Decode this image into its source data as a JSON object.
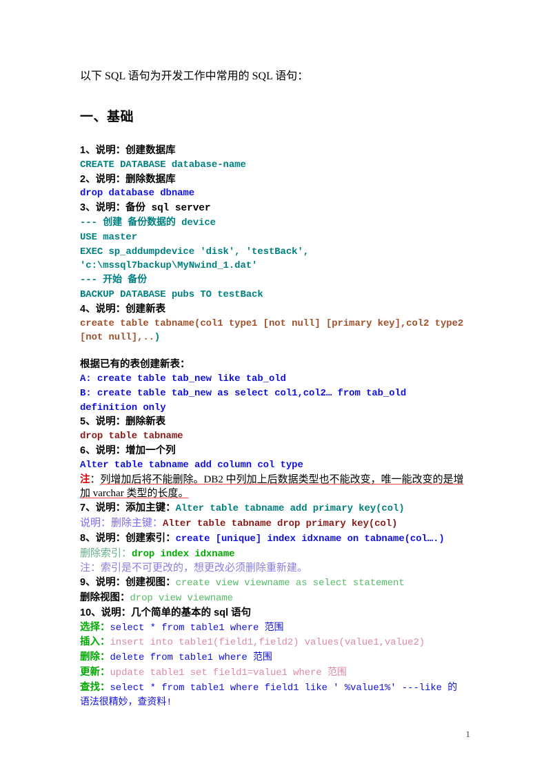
{
  "document": {
    "intro": "以下 SQL 语句为开发工作中常用的 SQL 语句：",
    "section_heading": "一、基础",
    "page_number": "1"
  },
  "colors": {
    "teal": "#008080",
    "blue": "#1111dd",
    "brown": "#a0522d",
    "dark_red": "#8b1a1a",
    "red": "#dd0000",
    "green": "#00aa00",
    "light_green": "#55bb66",
    "purple": "#7b68ee",
    "pink": "#dd88aa",
    "black": "#000000"
  },
  "items": {
    "i1_header": "1、说明：创建数据库",
    "i1_code": "CREATE DATABASE database-name",
    "i2_header": "2、说明：删除数据库",
    "i2_code": "drop database dbname",
    "i3_header_a": "3、说明：",
    "i3_header_b": "备份 sql server",
    "i3_comment1": "--- 创建 备份数据的 device",
    "i3_code1": "USE master",
    "i3_code2": "EXEC sp_addumpdevice 'disk', 'testBack', 'c:\\mssql7backup\\MyNwind_1.dat'",
    "i3_comment2": "--- 开始 备份",
    "i3_code3": "BACKUP DATABASE pubs TO testBack",
    "i4_header": "4、说明：创建新表",
    "i4_code": "create table tabname(col1 type1 [not null] [primary key],col2 type2 [not null],..",
    "i4_code_tail": ")",
    "i4b_header": "根据已有的表创建新表：",
    "i4b_code_a": "A: create table tab_new like tab_old",
    "i4b_code_b": "B: create table tab_new as select col1,col2… from tab_old definition only",
    "i5_header": "5、说明：删除新表",
    "i5_code": "drop table tabname",
    "i6_header": "6、说明：增加一个列",
    "i6_code": "Alter table tabname add column col type",
    "i6_note_label": "注",
    "i6_note_sep": "：",
    "i6_note_text": "列增加后将不能删除。DB2 中列加上后数据类型也不能改变，唯一能改变的是增加 varchar 类型的长度。",
    "i7_header": "7、说明：添加主键：",
    "i7_code": "Alter table tabname add primary key(col)",
    "i7_sub_label": "说明：",
    "i7_sub_label2": "删除主键：",
    "i7_sub_code": "Alter table tabname drop primary key(col)",
    "i8_header": "8、说明：创建索引：",
    "i8_code": "create [unique] index idxname on tabname(col….)",
    "i8_sub_label": "删除索引：",
    "i8_sub_code": "drop index idxname",
    "i8_note": "注：索引是不可更改的，想更改必须删除重新建。",
    "i9_header": "9、说明：创建视图：",
    "i9_code": "create view viewname as select statement",
    "i9_sub_label": "删除视图：",
    "i9_sub_code": "drop view viewname",
    "i10_header": "10、说明：几个简单的基本的 sql 语句",
    "i10_r1_label": "选择：",
    "i10_r1_code": "select * from table1 where 范围",
    "i10_r2_label": "插入：",
    "i10_r2_code": "insert into table1(field1,field2) values(value1,value2)",
    "i10_r3_label": "删除：",
    "i10_r3_code": "delete from table1 where 范围",
    "i10_r4_label": "更新：",
    "i10_r4_code": "update table1 set field1=value1 where 范围",
    "i10_r5_label": "查找：",
    "i10_r5_code": "select * from table1 where field1 like ' %value1%'  ---like 的语法很精妙，查资料!"
  }
}
